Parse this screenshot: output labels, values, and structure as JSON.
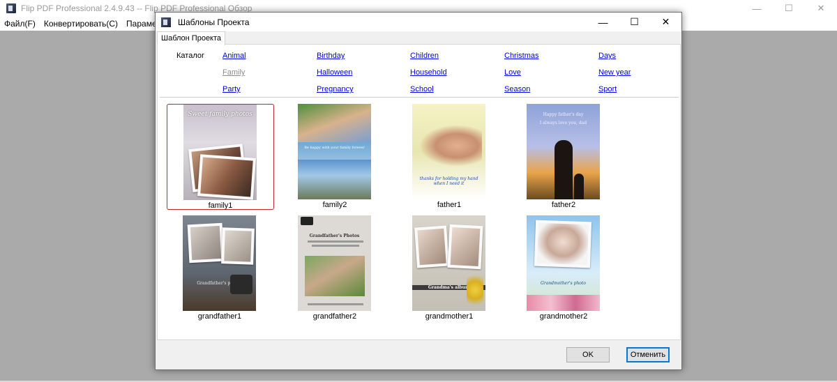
{
  "app": {
    "title": "Flip PDF Professional 2.4.9.43 -- Flip PDF Professional Обзор",
    "minimize": "—",
    "maximize": "☐",
    "close": "✕"
  },
  "menu": {
    "items": [
      "Файл(F)",
      "Конвертировать(C)",
      "Параметры"
    ]
  },
  "dialog": {
    "title": "Шаблоны Проекта",
    "minimize": "—",
    "maximize": "☐",
    "close": "✕",
    "tab": "Шаблон Проекта",
    "catalog_label": "Каталог",
    "categories": [
      [
        "Animal",
        "Birthday",
        "Children",
        "Christmas",
        "Days"
      ],
      [
        "Family",
        "Halloween",
        "Household",
        "Love",
        "New year"
      ],
      [
        "Party",
        "Pregnancy",
        "School",
        "Season",
        "Sport"
      ]
    ],
    "visited_category": "Family",
    "templates": [
      {
        "caption": "family1",
        "selected": true,
        "pic_text": "Sweet family photos"
      },
      {
        "caption": "family2",
        "selected": false,
        "pic_text": "Be happy with your family forever"
      },
      {
        "caption": "father1",
        "selected": false,
        "pic_text": "thanks for holding my hand when I need it"
      },
      {
        "caption": "father2",
        "selected": false,
        "pic_text": "Happy father's day\nI always love you, dad"
      },
      {
        "caption": "grandfather1",
        "selected": false,
        "pic_text": "Grandfather's photos"
      },
      {
        "caption": "grandfather2",
        "selected": false,
        "pic_text": "Grandfather's Photos"
      },
      {
        "caption": "grandmother1",
        "selected": false,
        "pic_text": "Grandma's album"
      },
      {
        "caption": "grandmother2",
        "selected": false,
        "pic_text": "Grandmother's photo"
      }
    ],
    "ok_label": "OK",
    "cancel_label": "Отменить"
  }
}
